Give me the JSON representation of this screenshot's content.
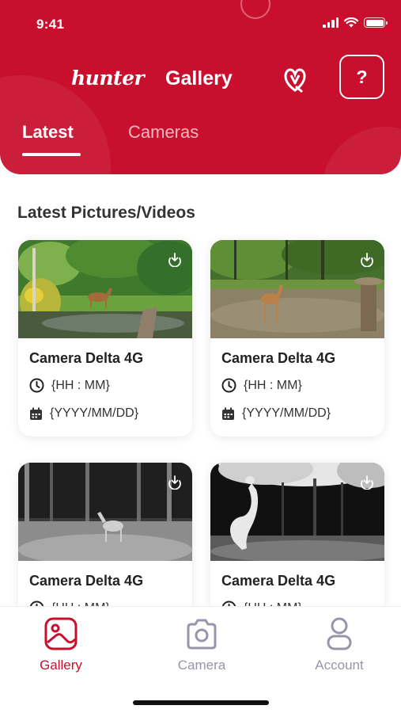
{
  "status_bar": {
    "time": "9:41"
  },
  "header": {
    "logo_text": "hunter",
    "title": "Gallery",
    "help_label": "?",
    "brand_icon": "brand-mark-icon",
    "accent_color": "#c8102e"
  },
  "tabs": [
    {
      "label": "Latest",
      "active": true
    },
    {
      "label": "Cameras",
      "active": false
    }
  ],
  "section_title": "Latest Pictures/Videos",
  "cards": [
    {
      "camera": "Camera Delta 4G",
      "time": "{HH : MM}",
      "date": "{YYYY/MM/DD}",
      "photo": "color-deer-in-pond"
    },
    {
      "camera": "Camera Delta 4G",
      "time": "{HH : MM}",
      "date": "{YYYY/MM/DD}",
      "photo": "color-fawn-in-woods"
    },
    {
      "camera": "Camera Delta 4G",
      "time": "{HH : MM}",
      "date": "",
      "photo": "night-deer-snow"
    },
    {
      "camera": "Camera Delta 4G",
      "time": "{HH : MM}",
      "date": "",
      "photo": "night-deer-jumping"
    }
  ],
  "bottom_nav": [
    {
      "label": "Gallery",
      "icon": "gallery-icon",
      "active": true
    },
    {
      "label": "Camera",
      "icon": "camera-icon",
      "active": false
    },
    {
      "label": "Account",
      "icon": "account-icon",
      "active": false
    }
  ]
}
